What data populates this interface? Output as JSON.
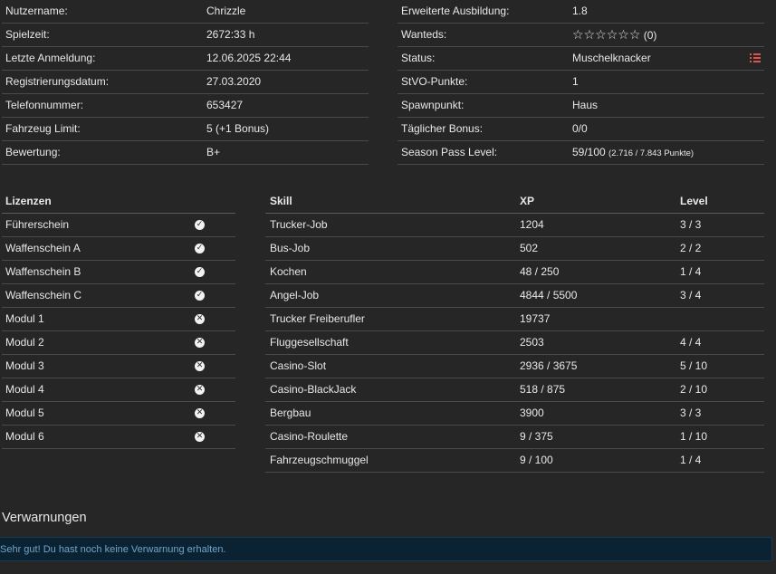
{
  "profile_left": [
    {
      "label": "Nutzername:",
      "value": "Chrizzle"
    },
    {
      "label": "Spielzeit:",
      "value": "2672:33 h"
    },
    {
      "label": "Letzte Anmeldung:",
      "value": "12.06.2025 22:44"
    },
    {
      "label": "Registrierungsdatum:",
      "value": "27.03.2020"
    },
    {
      "label": "Telefonnummer:",
      "value": "653427"
    },
    {
      "label": "Fahrzeug Limit:",
      "value": "5 (+1 Bonus)"
    },
    {
      "label": "Bewertung:",
      "value": "B+"
    }
  ],
  "profile_right": {
    "ausbildung": {
      "label": "Erweiterte Ausbildung:",
      "value": "1.8"
    },
    "wanteds": {
      "label": "Wanteds:",
      "stars_filled": 0,
      "stars_total": 6,
      "count_text": "(0)"
    },
    "status": {
      "label": "Status:",
      "value": "Muschelknacker",
      "icon": "list-icon"
    },
    "stvo": {
      "label": "StVO-Punkte:",
      "value": "1"
    },
    "spawn": {
      "label": "Spawnpunkt:",
      "value": "Haus"
    },
    "bonus": {
      "label": "Täglicher Bonus:",
      "value": "0/0"
    },
    "season": {
      "label": "Season Pass Level:",
      "value": "59/100",
      "detail": "(2.716 / 7.843 Punkte)"
    }
  },
  "licenses": {
    "header": "Lizenzen",
    "items": [
      {
        "name": "Führerschein",
        "status": "yes"
      },
      {
        "name": "Waffenschein A",
        "status": "yes"
      },
      {
        "name": "Waffenschein B",
        "status": "yes"
      },
      {
        "name": "Waffenschein C",
        "status": "yes"
      },
      {
        "name": "Modul 1",
        "status": "no"
      },
      {
        "name": "Modul 2",
        "status": "no"
      },
      {
        "name": "Modul 3",
        "status": "no"
      },
      {
        "name": "Modul 4",
        "status": "no"
      },
      {
        "name": "Modul 5",
        "status": "no"
      },
      {
        "name": "Modul 6",
        "status": "no"
      }
    ]
  },
  "skills": {
    "headers": {
      "skill": "Skill",
      "xp": "XP",
      "level": "Level"
    },
    "rows": [
      {
        "skill": "Trucker-Job",
        "xp": "1204",
        "level": "3 / 3"
      },
      {
        "skill": "Bus-Job",
        "xp": "502",
        "level": "2 / 2"
      },
      {
        "skill": "Kochen",
        "xp": "48 / 250",
        "level": "1 / 4"
      },
      {
        "skill": "Angel-Job",
        "xp": "4844 / 5500",
        "level": "3 / 4"
      },
      {
        "skill": "Trucker Freiberufler",
        "xp": "19737",
        "level": ""
      },
      {
        "skill": "Fluggesellschaft",
        "xp": "2503",
        "level": "4 / 4"
      },
      {
        "skill": "Casino-Slot",
        "xp": "2936 / 3675",
        "level": "5 / 10"
      },
      {
        "skill": "Casino-BlackJack",
        "xp": "518 / 875",
        "level": "2 / 10"
      },
      {
        "skill": "Bergbau",
        "xp": "3900",
        "level": "3 / 3"
      },
      {
        "skill": "Casino-Roulette",
        "xp": "9 / 375",
        "level": "1 / 10"
      },
      {
        "skill": "Fahrzeugschmuggel",
        "xp": "9 / 100",
        "level": "1 / 4"
      }
    ]
  },
  "warnings": {
    "title": "Verwarnungen",
    "message": "Sehr gut! Du hast noch keine Verwarnung erhalten."
  },
  "colors": {
    "background": "#262626",
    "alert_bg": "#0b2233",
    "alert_text": "#6fa6c9",
    "status_icon": "#d9534f"
  }
}
